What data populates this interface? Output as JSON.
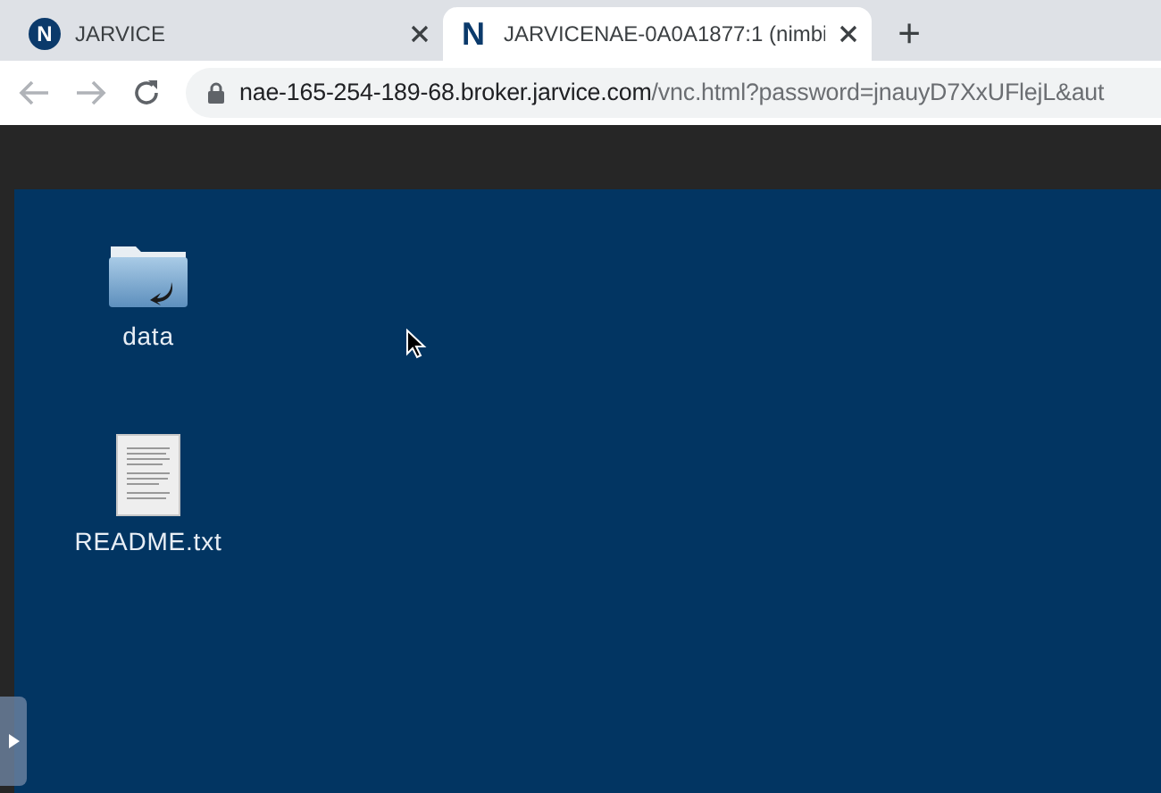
{
  "tabs": [
    {
      "favicon_letter": "N",
      "title": "JARVICE",
      "selected": false
    },
    {
      "favicon_letter": "N",
      "title": "JARVICENAE-0A0A1877:1 (nimbi",
      "selected": true
    }
  ],
  "new_tab": "+",
  "address_bar": {
    "host": "nae-165-254-189-68.broker.jarvice.com",
    "path": "/vnc.html?password=jnauyD7XxUFlejL&aut"
  },
  "desktop_icons": [
    {
      "kind": "folder",
      "label": "data"
    },
    {
      "kind": "text_file",
      "label": "README.txt"
    }
  ]
}
